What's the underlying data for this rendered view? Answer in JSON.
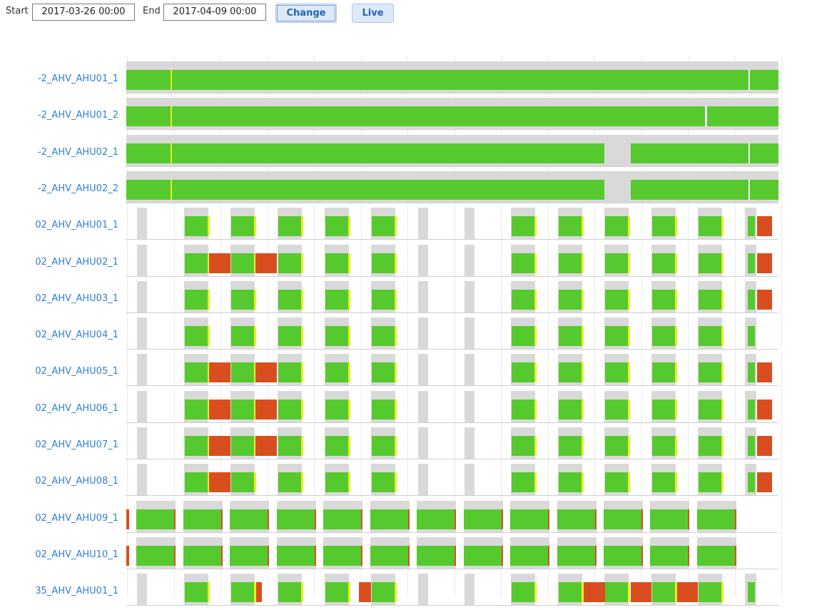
{
  "toolbar": {
    "start_label": "Start",
    "start_value": "2017-03-26 00:00",
    "end_label": "End",
    "end_value": "2017-04-09 00:00",
    "change_label": "Change",
    "live_label": "Live"
  },
  "colors": {
    "on": "#56c92e",
    "fault": "#d94e1f",
    "transition": "#eded2a",
    "scheduled": "#d9d9d9",
    "label": "#2f7ed8"
  },
  "chart": {
    "rows": [
      {
        "label": "-2_AHV_AHU01_1"
      },
      {
        "label": "-2_AHV_AHU01_2"
      },
      {
        "label": "-2_AHV_AHU02_1"
      },
      {
        "label": "-2_AHV_AHU02_2"
      },
      {
        "label": "02_AHV_AHU01_1"
      },
      {
        "label": "02_AHV_AHU02_1"
      },
      {
        "label": "02_AHV_AHU03_1"
      },
      {
        "label": "02_AHV_AHU04_1"
      },
      {
        "label": "02_AHV_AHU05_1"
      },
      {
        "label": "02_AHV_AHU06_1"
      },
      {
        "label": "02_AHV_AHU07_1"
      },
      {
        "label": "02_AHV_AHU08_1"
      },
      {
        "label": "02_AHV_AHU09_1"
      },
      {
        "label": "02_AHV_AHU10_1"
      },
      {
        "label": "35_AHV_AHU01_1"
      }
    ]
  }
}
